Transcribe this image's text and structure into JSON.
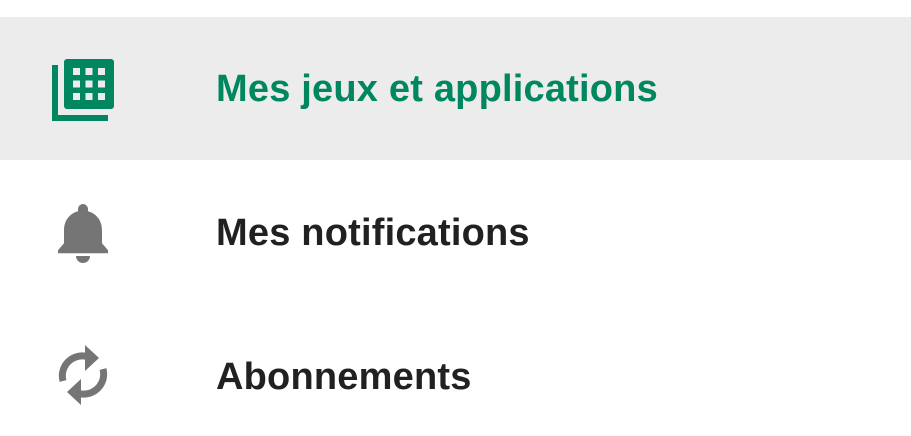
{
  "colors": {
    "accent": "#01875f",
    "text": "#212121",
    "icon": "#757575",
    "selected_background": "#ececec"
  },
  "menu": {
    "items": [
      {
        "label": "Mes jeux et applications",
        "icon": "apps-grid-icon",
        "selected": true
      },
      {
        "label": "Mes notifications",
        "icon": "bell-icon",
        "selected": false
      },
      {
        "label": "Abonnements",
        "icon": "refresh-icon",
        "selected": false
      }
    ]
  }
}
